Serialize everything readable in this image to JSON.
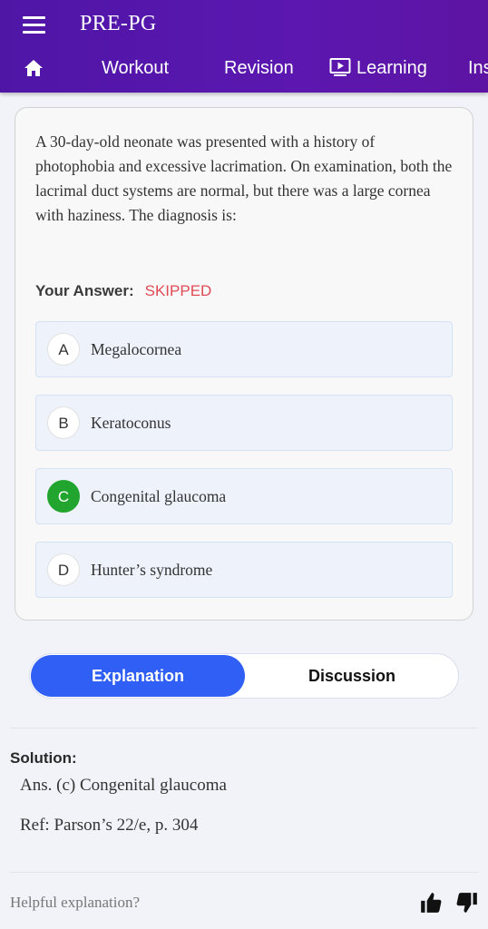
{
  "app": {
    "title": "PRE-PG"
  },
  "nav": {
    "items": [
      {
        "label": "Workout"
      },
      {
        "label": "Revision"
      },
      {
        "label": "Learning"
      },
      {
        "label": "Ins"
      }
    ]
  },
  "question": {
    "text": "A 30-day-old neonate was presented with a history of photophobia and excessive lacrimation. On examination, both the lacrimal duct systems are normal, but there was a large cornea with haziness. The diagnosis is:",
    "your_answer_label": "Your Answer:",
    "your_answer_value": "SKIPPED",
    "options": [
      {
        "letter": "A",
        "text": "Megalocornea",
        "correct": false
      },
      {
        "letter": "B",
        "text": "Keratoconus",
        "correct": false
      },
      {
        "letter": "C",
        "text": "Congenital glaucoma",
        "correct": true
      },
      {
        "letter": "D",
        "text": "Hunter’s syndrome",
        "correct": false
      }
    ]
  },
  "tabs": {
    "explanation": "Explanation",
    "discussion": "Discussion"
  },
  "solution": {
    "title": "Solution:",
    "answer": "Ans. (c) Congenital glaucoma",
    "reference": "Ref: Parson’s 22/e, p. 304"
  },
  "feedback": {
    "prompt": "Helpful explanation?"
  },
  "colors": {
    "header": "#5b17b0",
    "correct": "#21a52f",
    "skipped": "#e04b55",
    "active_tab": "#2f5ff5"
  }
}
